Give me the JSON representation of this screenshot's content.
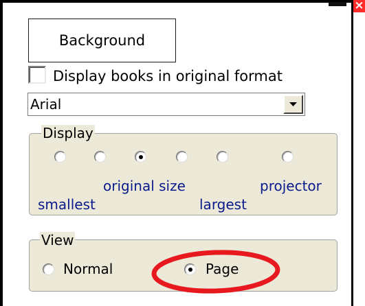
{
  "button": {
    "background_label": "Background"
  },
  "checkbox": {
    "label": "Display books in original format",
    "checked": false
  },
  "font_select": {
    "value": "Arial"
  },
  "display_group": {
    "title": "Display",
    "options": [
      {
        "label": "smallest",
        "selected": false
      },
      {
        "label": "",
        "selected": false
      },
      {
        "label": "original size",
        "selected": true
      },
      {
        "label": "",
        "selected": false
      },
      {
        "label": "largest",
        "selected": false
      },
      {
        "label": "projector",
        "selected": false
      }
    ]
  },
  "view_group": {
    "title": "View",
    "options": [
      {
        "label": "Normal",
        "selected": false
      },
      {
        "label": "Page",
        "selected": true
      }
    ]
  },
  "icons": {
    "close": "close-icon"
  },
  "colors": {
    "option_label": "#0a1a8c",
    "highlight": "#e8191e",
    "panel": "#ece9d8"
  }
}
